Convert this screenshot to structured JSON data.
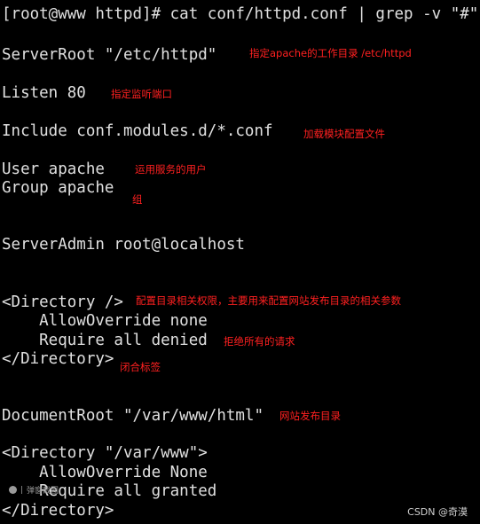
{
  "terminal": {
    "lines": {
      "prompt": "[root@www httpd]# cat conf/httpd.conf | grep -v \"#\"",
      "server_root": "ServerRoot \"/etc/httpd\"",
      "listen": "Listen 80",
      "include": "Include conf.modules.d/*.conf",
      "user": "User apache",
      "group": "Group apache",
      "server_admin": "ServerAdmin root@localhost",
      "dir_root_open": "<Directory />",
      "dir_root_override": "    AllowOverride none",
      "dir_root_require": "    Require all denied",
      "dir_root_close": "</Directory>",
      "document_root": "DocumentRoot \"/var/www/html\"",
      "dir_www_open": "<Directory \"/var/www\">",
      "dir_www_override": "    AllowOverride None",
      "dir_www_require": "    Require all granted",
      "dir_www_close": "</Directory>"
    }
  },
  "annotations": {
    "server_root": "指定apache的工作目录  /etc/httpd",
    "listen": "指定监听端口",
    "include": "加载模块配置文件",
    "user": "运用服务的用户",
    "group": "组",
    "dir_root": "配置目录相关权限，主要用来配置网站发布目录的相关参数",
    "denied": "拒绝所有的请求",
    "close_tag": "闭合标签",
    "document_root": "网站发布目录"
  },
  "watermark": {
    "text": "弹窗截图"
  },
  "credit": "CSDN @奇漠",
  "colors": {
    "background": "#000000",
    "terminal_text": "#e0e0e0",
    "annotation": "#ff2020"
  }
}
